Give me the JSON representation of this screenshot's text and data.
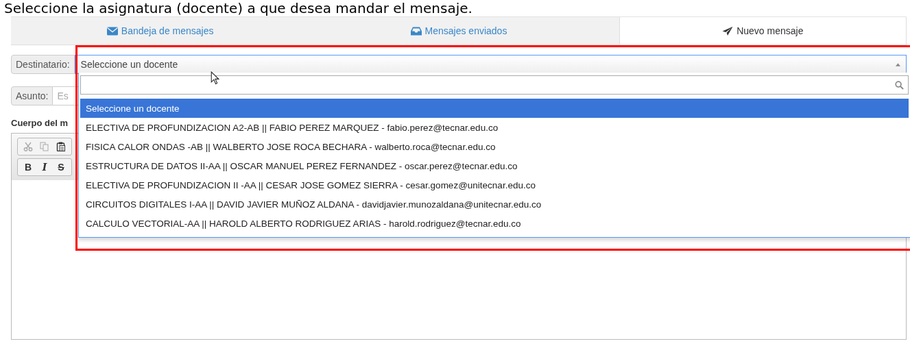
{
  "caption": "Seleccione la asignatura (docente) a que desea mandar el mensaje.",
  "tabs": [
    {
      "label": "Bandeja de mensajes",
      "kind": "envelope",
      "selected": false
    },
    {
      "label": "Mensajes enviados",
      "kind": "inbox",
      "selected": false
    },
    {
      "label": "Nuevo mensaje",
      "kind": "plane",
      "selected": true
    }
  ],
  "recipient": {
    "label": "Destinatario:",
    "value": "Seleccione un docente",
    "options": [
      {
        "label": "Seleccione un docente",
        "selected": true
      },
      {
        "label": "ELECTIVA DE PROFUNDIZACION A2-AB || FABIO PEREZ MARQUEZ - fabio.perez@tecnar.edu.co",
        "selected": false
      },
      {
        "label": "FISICA CALOR ONDAS -AB || WALBERTO JOSE ROCA BECHARA - walberto.roca@tecnar.edu.co",
        "selected": false
      },
      {
        "label": "ESTRUCTURA DE DATOS II-AA || OSCAR MANUEL PEREZ FERNANDEZ - oscar.perez@tecnar.edu.co",
        "selected": false
      },
      {
        "label": "ELECTIVA DE PROFUNDIZACION II -AA || CESAR JOSE GOMEZ SIERRA - cesar.gomez@unitecnar.edu.co",
        "selected": false
      },
      {
        "label": "CIRCUITOS DIGITALES I-AA || DAVID JAVIER MUÑOZ ALDANA - davidjavier.munozaldana@unitecnar.edu.co",
        "selected": false
      },
      {
        "label": "CALCULO VECTORIAL-AA || HAROLD ALBERTO RODRIGUEZ ARIAS - harold.rodriguez@tecnar.edu.co",
        "selected": false
      }
    ]
  },
  "subject": {
    "label": "Asunto:",
    "placeholder": "Es"
  },
  "body": {
    "label": "Cuerpo del m",
    "toolbar": [
      [
        {
          "kind": "cut",
          "disabled": true
        },
        {
          "kind": "copy",
          "disabled": true
        },
        {
          "kind": "paste",
          "disabled": false
        }
      ],
      [
        {
          "kind": "bold",
          "label": "B"
        },
        {
          "kind": "italic",
          "label": "I"
        },
        {
          "kind": "strike",
          "label": "S"
        }
      ]
    ]
  }
}
